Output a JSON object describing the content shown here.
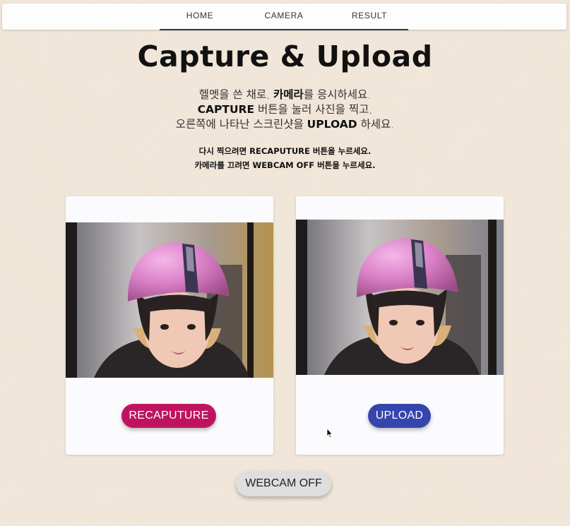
{
  "nav": {
    "items": [
      {
        "label": "HOME"
      },
      {
        "label": "CAMERA"
      },
      {
        "label": "RESULT"
      }
    ]
  },
  "title": "Capture & Upload",
  "intro": {
    "line1_a": "헬멧을 쓴 채로, ",
    "line1_b": "카메라",
    "line1_c": "를 응시하세요.",
    "line2_a": "CAPTURE",
    "line2_b": " 버튼을 눌러 사진을 찍고,",
    "line3_a": "오른쪽에 나타난 스크린샷을 ",
    "line3_b": "UPLOAD",
    "line3_c": " 하세요."
  },
  "hint": {
    "line1": "다시 찍으려면 RECAPUTURE 버튼을 누르세요.",
    "line2": "카메라를 끄려면 WEBCAM OFF 버튼을 누르세요."
  },
  "webcam_card": {
    "button_label": "RECAPUTURE"
  },
  "capture_card": {
    "button_label": "UPLOAD"
  },
  "webcam_off_label": "WEBCAM OFF",
  "colors": {
    "background": "#f1e6d8",
    "recapture": "#c0135e",
    "upload": "#3545ad",
    "webcam_off": "#dedede"
  }
}
